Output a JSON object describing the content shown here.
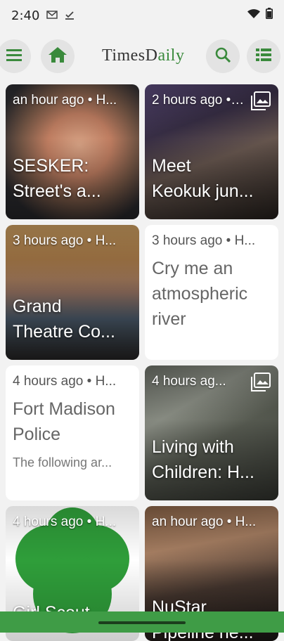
{
  "status_bar": {
    "time": "2:40",
    "notification_icons": [
      "gmail-icon",
      "check-download-icon"
    ],
    "right_icons": [
      "wifi-icon",
      "battery-icon"
    ]
  },
  "header": {
    "logo_part1": "TimesD",
    "logo_part2": "aily",
    "buttons": [
      "menu-icon",
      "home-icon",
      "search-icon",
      "list-icon"
    ],
    "brand_color": "#3a8a3c"
  },
  "cards": [
    {
      "kind": "image",
      "meta": "an hour ago • H...",
      "title_line1": "SESKER:",
      "title_line2": "Street's a...",
      "gallery": false
    },
    {
      "kind": "image",
      "meta": "2 hours ago • H...",
      "title_line1": "Meet",
      "title_line2": "Keokuk jun...",
      "gallery": true
    },
    {
      "kind": "image",
      "meta": "3 hours ago • H...",
      "title_line1": "Grand",
      "title_line2": "Theatre Co...",
      "gallery": false
    },
    {
      "kind": "text",
      "meta": "3 hours ago • H...",
      "title": "Cry me an atmospheric river",
      "desc": ""
    },
    {
      "kind": "text",
      "meta": "4 hours ago • H...",
      "title": "Fort Madison Police",
      "desc": "The following ar..."
    },
    {
      "kind": "image",
      "meta": "4 hours ag...",
      "title_line1": "Living with",
      "title_line2": "Children: H...",
      "gallery": true
    },
    {
      "kind": "image",
      "meta": "4 hours ago • H...",
      "title_line1": "Girl Scout",
      "title_line2": "",
      "gallery": false
    },
    {
      "kind": "image",
      "meta": "an hour ago • H...",
      "title_line1": "NuStar",
      "title_line2": "Pipeline he...",
      "gallery": false
    }
  ],
  "nav_bar_color": "#3f9c46"
}
